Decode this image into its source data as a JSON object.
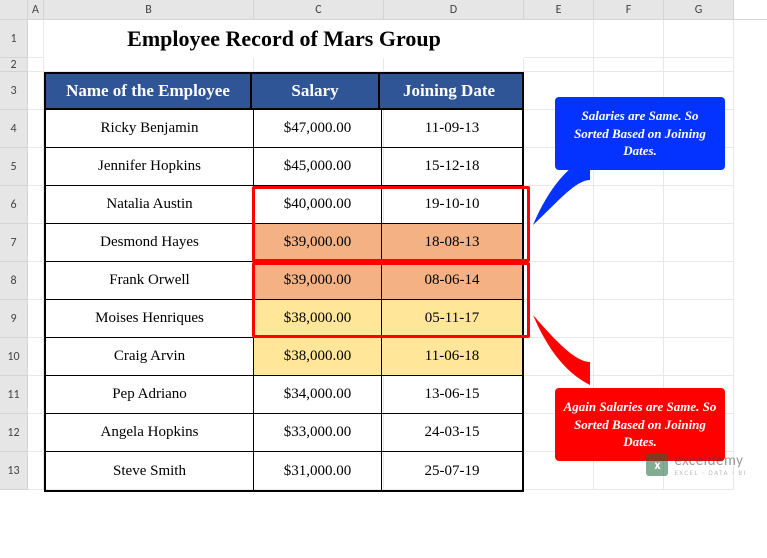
{
  "chart_data": {
    "type": "table",
    "title": "Employee Record of Mars Group",
    "columns": [
      "Name of the Employee",
      "Salary",
      "Joining Date"
    ],
    "rows": [
      [
        "Ricky Benjamin",
        "$47,000.00",
        "11-09-13"
      ],
      [
        "Jennifer Hopkins",
        "$45,000.00",
        "15-12-18"
      ],
      [
        "Natalia Austin",
        "$40,000.00",
        "19-10-10"
      ],
      [
        "Desmond Hayes",
        "$39,000.00",
        "18-08-13"
      ],
      [
        "Frank Orwell",
        "$39,000.00",
        "08-06-14"
      ],
      [
        "Moises Henriques",
        "$38,000.00",
        "05-11-17"
      ],
      [
        "Craig Arvin",
        "$38,000.00",
        "11-06-18"
      ],
      [
        "Pep Adriano",
        "$34,000.00",
        "13-06-15"
      ],
      [
        "Angela Hopkins",
        "$33,000.00",
        "24-03-15"
      ],
      [
        "Steve Smith",
        "$31,000.00",
        "25-07-19"
      ]
    ],
    "highlight_orange_rows": [
      3,
      4
    ],
    "highlight_yellow_rows": [
      5,
      6
    ]
  },
  "columns": {
    "A": "A",
    "B": "B",
    "C": "C",
    "D": "D",
    "E": "E",
    "F": "F",
    "G": "G"
  },
  "row_numbers": [
    "1",
    "2",
    "3",
    "4",
    "5",
    "6",
    "7",
    "8",
    "9",
    "10",
    "11",
    "12",
    "13"
  ],
  "title": "Employee Record of Mars Group",
  "headers": {
    "name": "Name of the Employee",
    "salary": "Salary",
    "date": "Joining Date"
  },
  "data": [
    {
      "name": "Ricky Benjamin",
      "salary": "$47,000.00",
      "date": "11-09-13"
    },
    {
      "name": "Jennifer Hopkins",
      "salary": "$45,000.00",
      "date": "15-12-18"
    },
    {
      "name": "Natalia Austin",
      "salary": "$40,000.00",
      "date": "19-10-10"
    },
    {
      "name": "Desmond Hayes",
      "salary": "$39,000.00",
      "date": "18-08-13"
    },
    {
      "name": "Frank Orwell",
      "salary": "$39,000.00",
      "date": "08-06-14"
    },
    {
      "name": "Moises Henriques",
      "salary": "$38,000.00",
      "date": "05-11-17"
    },
    {
      "name": "Craig Arvin",
      "salary": "$38,000.00",
      "date": "11-06-18"
    },
    {
      "name": "Pep Adriano",
      "salary": "$34,000.00",
      "date": "13-06-15"
    },
    {
      "name": "Angela Hopkins",
      "salary": "$33,000.00",
      "date": "24-03-15"
    },
    {
      "name": "Steve Smith",
      "salary": "$31,000.00",
      "date": "25-07-19"
    }
  ],
  "callouts": {
    "blue": "Salaries are Same. So Sorted Based on Joining Dates.",
    "red": "Again Salaries are Same. So Sorted Based on Joining Dates."
  },
  "watermark": {
    "brand": "exceldemy",
    "tag": "EXCEL · DATA · BI",
    "logo": "x"
  }
}
